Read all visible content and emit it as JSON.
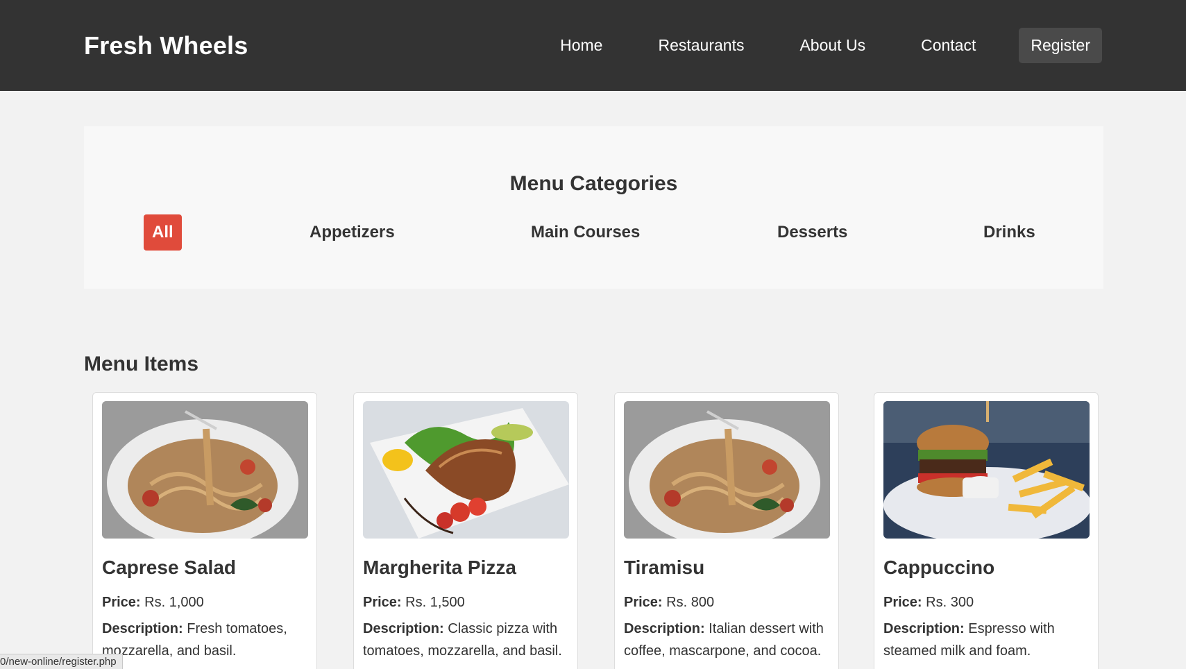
{
  "header": {
    "logo": "Fresh Wheels",
    "nav": [
      {
        "label": "Home"
      },
      {
        "label": "Restaurants"
      },
      {
        "label": "About Us"
      },
      {
        "label": "Contact"
      }
    ],
    "register_label": "Register"
  },
  "categories": {
    "title": "Menu Categories",
    "items": [
      {
        "label": "All",
        "active": true
      },
      {
        "label": "Appetizers"
      },
      {
        "label": "Main Courses"
      },
      {
        "label": "Desserts"
      },
      {
        "label": "Drinks"
      }
    ]
  },
  "menu": {
    "title": "Menu Items",
    "price_label": "Price:",
    "desc_label": "Description:",
    "items": [
      {
        "name": "Caprese Salad",
        "price": "Rs. 1,000",
        "desc_line1": "Fresh tomatoes,",
        "desc_line2": "mozzarella, and basil.",
        "image": "pasta-plate-image"
      },
      {
        "name": "Margherita Pizza",
        "price": "Rs. 1,500",
        "desc_line1": "Classic pizza with",
        "desc_line2": "tomatoes, mozzarella, and basil.",
        "image": "salmon-plate-image"
      },
      {
        "name": "Tiramisu",
        "price": "Rs. 800",
        "desc_line1": "Italian dessert with",
        "desc_line2": "coffee, mascarpone, and cocoa.",
        "image": "pasta-plate-image"
      },
      {
        "name": "Cappuccino",
        "price": "Rs. 300",
        "desc_line1": "Espresso with",
        "desc_line2": "steamed milk and foam.",
        "image": "burger-fries-image"
      }
    ]
  },
  "status_url": "0/new-online/register.php",
  "colors": {
    "header_bg": "#333333",
    "accent": "#e04b3b",
    "page_bg": "#f2f2f2"
  }
}
